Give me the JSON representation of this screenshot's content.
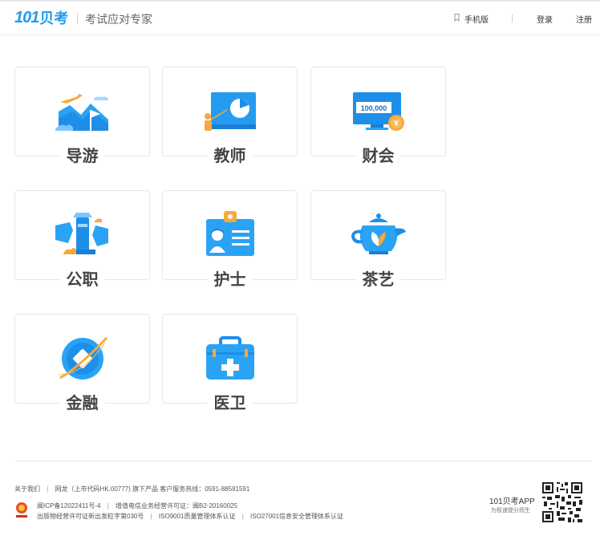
{
  "header": {
    "logo_number": "101",
    "logo_text": "贝考",
    "slogan": "考试应对专家",
    "mobile_label": "手机版",
    "login_label": "登录",
    "register_label": "注册"
  },
  "cards": [
    {
      "label": "导游",
      "icon": "tour-guide-icon"
    },
    {
      "label": "教师",
      "icon": "teacher-icon"
    },
    {
      "label": "财会",
      "icon": "accounting-icon",
      "icon_text": "100,000",
      "coin_text": "¥"
    },
    {
      "label": "公职",
      "icon": "civil-service-icon"
    },
    {
      "label": "护士",
      "icon": "nurse-icon"
    },
    {
      "label": "茶艺",
      "icon": "tea-art-icon"
    },
    {
      "label": "金融",
      "icon": "finance-icon"
    },
    {
      "label": "医卫",
      "icon": "medical-icon"
    }
  ],
  "footer": {
    "about": "关于我们",
    "company": "网龙（上市代码HK.00777) 旗下产品 客户服务热线：0591-88591591",
    "icp": "闽ICP备12022411号-4",
    "telecom": "增值电信业务经营许可证：闽B2-20160025",
    "publish": "出版物经营许可证新出发粒字第030号",
    "iso9001": "ISO9001质量管理体系认证",
    "iso27001": "ISO27001信息安全管理体系认证",
    "app_title": "101贝考APP",
    "app_sub": "为极速提分而生"
  },
  "colors": {
    "brand_blue": "#1f9bf0",
    "accent_orange": "#f7a93b"
  }
}
